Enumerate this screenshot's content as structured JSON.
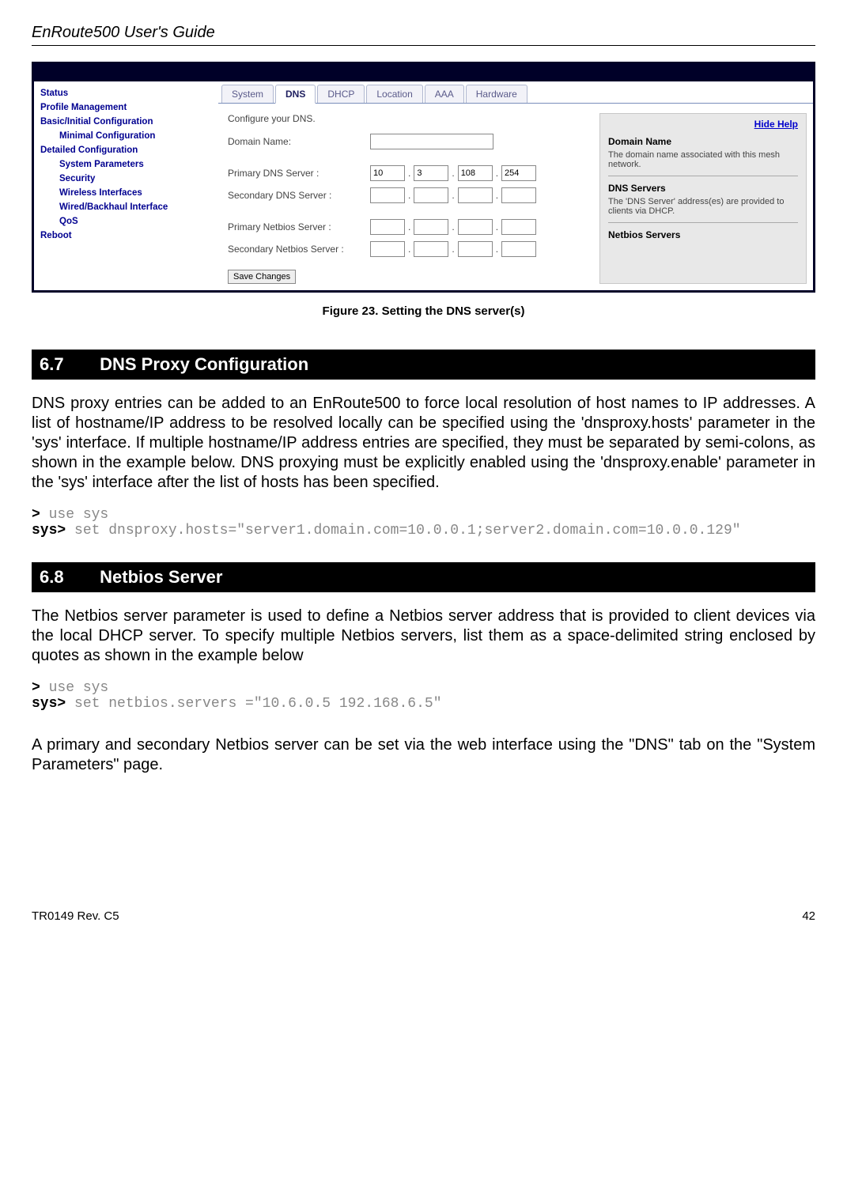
{
  "header": {
    "title": "EnRoute500 User's Guide"
  },
  "screenshot": {
    "sidebar": {
      "items": [
        {
          "label": "Status",
          "sub": false
        },
        {
          "label": "Profile Management",
          "sub": false
        },
        {
          "label": "Basic/Initial Configuration",
          "sub": false
        },
        {
          "label": "Minimal Configuration",
          "sub": true
        },
        {
          "label": "Detailed Configuration",
          "sub": false
        },
        {
          "label": "System Parameters",
          "sub": true
        },
        {
          "label": "Security",
          "sub": true
        },
        {
          "label": "Wireless Interfaces",
          "sub": true
        },
        {
          "label": "Wired/Backhaul Interface",
          "sub": true
        },
        {
          "label": "QoS",
          "sub": true
        },
        {
          "label": "Reboot",
          "sub": false
        }
      ]
    },
    "tabs": [
      {
        "label": "System",
        "active": false
      },
      {
        "label": "DNS",
        "active": true
      },
      {
        "label": "DHCP",
        "active": false
      },
      {
        "label": "Location",
        "active": false
      },
      {
        "label": "AAA",
        "active": false
      },
      {
        "label": "Hardware",
        "active": false
      }
    ],
    "form": {
      "intro": "Configure your DNS.",
      "domain_label": "Domain Name:",
      "primary_dns_label": "Primary DNS Server :",
      "secondary_dns_label": "Secondary DNS Server :",
      "primary_netbios_label": "Primary Netbios Server :",
      "secondary_netbios_label": "Secondary Netbios Server :",
      "primary_dns": [
        "10",
        "3",
        "108",
        "254"
      ],
      "secondary_dns": [
        "",
        "",
        "",
        ""
      ],
      "primary_netbios": [
        "",
        "",
        "",
        ""
      ],
      "secondary_netbios": [
        "",
        "",
        "",
        ""
      ],
      "save_button": "Save Changes"
    },
    "help": {
      "hide_link": "Hide Help",
      "h1": "Domain Name",
      "p1": "The domain name associated with this mesh network.",
      "h2": "DNS Servers",
      "p2": "The 'DNS Server' address(es) are provided to clients via DHCP.",
      "h3": "Netbios Servers"
    }
  },
  "figure_caption": "Figure 23. Setting the DNS server(s)",
  "section_67": {
    "num": "6.7",
    "title": "DNS Proxy Configuration",
    "body": "DNS proxy entries can be added to an EnRoute500 to force local resolution of host names to IP addresses. A list of hostname/IP address to be resolved locally can be specified using the 'dnsproxy.hosts' parameter in the 'sys' interface. If multiple hostname/IP address entries are specified, they must be separated by semi-colons, as shown in the example below. DNS proxying must be explicitly enabled using the 'dnsproxy.enable' parameter in the 'sys' interface after the list of hosts has been specified.",
    "code_prompt1": ">",
    "code_line1": " use sys",
    "code_prompt2": "sys>",
    "code_line2": " set dnsproxy.hosts=\"server1.domain.com=10.0.0.1;server2.domain.com=10.0.0.129\""
  },
  "section_68": {
    "num": "6.8",
    "title": "Netbios Server",
    "body1": "The Netbios server parameter is used to define a Netbios server address that is provided to client devices via the local DHCP server. To specify multiple Netbios servers, list them as a space-delimited string enclosed by quotes as shown in the example below",
    "code_prompt1": ">",
    "code_line1": " use sys",
    "code_prompt2": "sys>",
    "code_line2": " set netbios.servers =\"10.6.0.5 192.168.6.5\"",
    "body2": "A primary and secondary Netbios server can be set via the web interface using the \"DNS\" tab on the \"System Parameters\" page."
  },
  "footer": {
    "left": "TR0149 Rev. C5",
    "right": "42"
  }
}
